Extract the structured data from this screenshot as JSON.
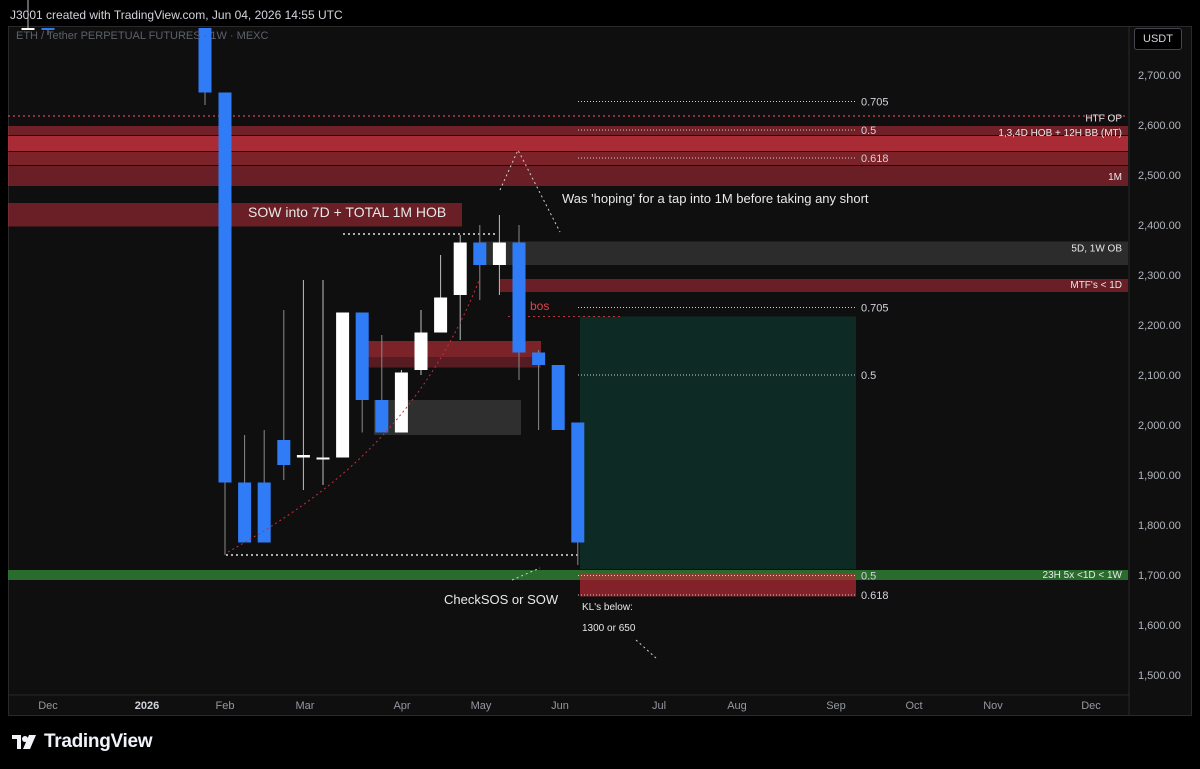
{
  "header": {
    "caption": "J3001 created with TradingView.com, Jun 04, 2026 14:55 UTC"
  },
  "chart_header": {
    "symbol": "ETH / Tether PERPETUAL FUTURES · 1W · MEXC",
    "unit": "USDT"
  },
  "footer": {
    "brand": "TradingView"
  },
  "colors": {
    "background": "#0f0f0f",
    "up_candle": "#ffffff",
    "down_candle": "#2f7cf6",
    "red_zone": "#c4303c",
    "green_zone": "#2e7d32",
    "target_zone": "#0d2a24",
    "stop_zone": "#b52a35",
    "fvg_grey": "#505050"
  },
  "chart_data": {
    "type": "candlestick",
    "timeframe": "1W",
    "ylim": [
      1450,
      2780
    ],
    "y_ticks": [
      "2,700.00",
      "2,600.00",
      "2,500.00",
      "2,400.00",
      "2,300.00",
      "2,200.00",
      "2,100.00",
      "2,000.00",
      "1,900.00",
      "1,800.00",
      "1,700.00",
      "1,600.00",
      "1,500.00"
    ],
    "x_ticks": [
      "Dec",
      "2026",
      "Feb",
      "Mar",
      "Apr",
      "May",
      "Jun",
      "Jul",
      "Aug",
      "Sep",
      "Oct",
      "Nov",
      "Dec"
    ],
    "candles": [
      {
        "o": 2960,
        "h": 3000,
        "l": 2910,
        "c": 2960
      },
      {
        "o": 2900,
        "h": 2950,
        "l": 2780,
        "c": 2800
      },
      {
        "o": 3010,
        "h": 3030,
        "l": 2640,
        "c": 2665
      },
      {
        "o": 2665,
        "h": 2390,
        "l": 1740,
        "c": 1885
      },
      {
        "o": 1885,
        "h": 1980,
        "l": 1790,
        "c": 1765
      },
      {
        "o": 1885,
        "h": 1990,
        "l": 1890,
        "c": 1765
      },
      {
        "o": 1970,
        "h": 2230,
        "l": 1890,
        "c": 1920
      },
      {
        "o": 1935,
        "h": 2290,
        "l": 1870,
        "c": 1940
      },
      {
        "o": 1935,
        "h": 2290,
        "l": 1880,
        "c": 1935
      },
      {
        "o": 1935,
        "h": 2205,
        "l": 1935,
        "c": 2225
      },
      {
        "o": 2225,
        "h": 2220,
        "l": 1985,
        "c": 2050
      },
      {
        "o": 2050,
        "h": 2180,
        "l": 1990,
        "c": 1985
      },
      {
        "o": 1985,
        "h": 2110,
        "l": 1990,
        "c": 2105
      },
      {
        "o": 2110,
        "h": 2230,
        "l": 2100,
        "c": 2185
      },
      {
        "o": 2185,
        "h": 2340,
        "l": 2185,
        "c": 2255
      },
      {
        "o": 2260,
        "h": 2380,
        "l": 2170,
        "c": 2365
      },
      {
        "o": 2365,
        "h": 2400,
        "l": 2250,
        "c": 2320
      },
      {
        "o": 2320,
        "h": 2420,
        "l": 2260,
        "c": 2365
      },
      {
        "o": 2365,
        "h": 2400,
        "l": 2090,
        "c": 2145
      },
      {
        "o": 2145,
        "h": 2150,
        "l": 1990,
        "c": 2120
      },
      {
        "o": 2120,
        "h": 2120,
        "l": 2000,
        "c": 1990
      },
      {
        "o": 2005,
        "h": 2005,
        "l": 1720,
        "c": 1765
      }
    ],
    "annotations": [
      {
        "text": "SOW into 7D + TOTAL 1M HOB"
      },
      {
        "text": "Was 'hoping' for a tap into 1M before taking any short"
      },
      {
        "text": "bos"
      },
      {
        "text": "CheckSOS or SOW"
      },
      {
        "text": "KL's below:"
      },
      {
        "text": "1300 or 650"
      }
    ],
    "levels": [
      {
        "label": "HTF OP",
        "price": 2615
      },
      {
        "label": "1,3,4D HOB + 12H BB (MT)",
        "price": 2586
      },
      {
        "label": "1M",
        "price": 2498
      },
      {
        "label": "5D, 1W OB",
        "price": 2355
      },
      {
        "label": "MTF's < 1D",
        "price": 2282
      },
      {
        "label": "23H 5x <1D < 1W",
        "price": 1702
      }
    ],
    "fib_levels": [
      {
        "label": "0.705",
        "price": 2647
      },
      {
        "label": "0.5",
        "price": 2590
      },
      {
        "label": "0.618",
        "price": 2534
      },
      {
        "label": "0.705",
        "price": 2235
      },
      {
        "label": "0.5",
        "price": 2100
      },
      {
        "label": "0.5",
        "price": 1699
      },
      {
        "label": "0.618",
        "price": 1660
      }
    ]
  }
}
